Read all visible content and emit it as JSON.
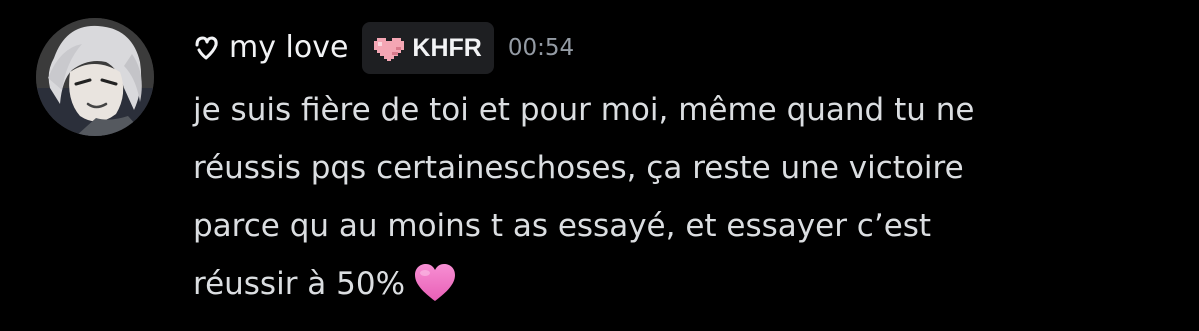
{
  "message": {
    "author": {
      "username": "my love",
      "avatar_icon": "avatar-anime-character",
      "name_glyph_icon": "heart-outline-glyph-icon"
    },
    "tag": {
      "label": "KHFR",
      "icon": "pixel-heart-icon",
      "icon_color": "#f4a6b4"
    },
    "timestamp": "00:54",
    "content_lines": [
      "je suis fière de toi et pour moi, même quand tu ne",
      "réussis pqs certaineschoses, ça reste une victoire",
      "parce qu au moins t as essayé, et essayer c’est",
      "réussir à 50%"
    ],
    "emoji": {
      "name": "pink-heart-icon",
      "color": "#f47fc8"
    }
  },
  "colors": {
    "background": "#000000",
    "username": "#f2f3f5",
    "message_text": "#dbdee1",
    "timestamp": "#949ba4",
    "tag_background": "#1e1f22"
  }
}
